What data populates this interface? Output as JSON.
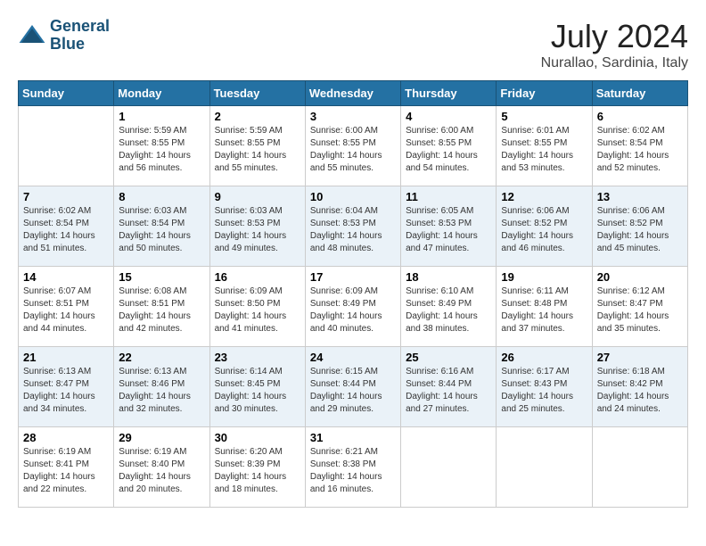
{
  "header": {
    "logo_line1": "General",
    "logo_line2": "Blue",
    "month_year": "July 2024",
    "location": "Nurallao, Sardinia, Italy"
  },
  "columns": [
    "Sunday",
    "Monday",
    "Tuesday",
    "Wednesday",
    "Thursday",
    "Friday",
    "Saturday"
  ],
  "weeks": [
    [
      {
        "day": "",
        "info": ""
      },
      {
        "day": "1",
        "info": "Sunrise: 5:59 AM\nSunset: 8:55 PM\nDaylight: 14 hours\nand 56 minutes."
      },
      {
        "day": "2",
        "info": "Sunrise: 5:59 AM\nSunset: 8:55 PM\nDaylight: 14 hours\nand 55 minutes."
      },
      {
        "day": "3",
        "info": "Sunrise: 6:00 AM\nSunset: 8:55 PM\nDaylight: 14 hours\nand 55 minutes."
      },
      {
        "day": "4",
        "info": "Sunrise: 6:00 AM\nSunset: 8:55 PM\nDaylight: 14 hours\nand 54 minutes."
      },
      {
        "day": "5",
        "info": "Sunrise: 6:01 AM\nSunset: 8:55 PM\nDaylight: 14 hours\nand 53 minutes."
      },
      {
        "day": "6",
        "info": "Sunrise: 6:02 AM\nSunset: 8:54 PM\nDaylight: 14 hours\nand 52 minutes."
      }
    ],
    [
      {
        "day": "7",
        "info": "Sunrise: 6:02 AM\nSunset: 8:54 PM\nDaylight: 14 hours\nand 51 minutes."
      },
      {
        "day": "8",
        "info": "Sunrise: 6:03 AM\nSunset: 8:54 PM\nDaylight: 14 hours\nand 50 minutes."
      },
      {
        "day": "9",
        "info": "Sunrise: 6:03 AM\nSunset: 8:53 PM\nDaylight: 14 hours\nand 49 minutes."
      },
      {
        "day": "10",
        "info": "Sunrise: 6:04 AM\nSunset: 8:53 PM\nDaylight: 14 hours\nand 48 minutes."
      },
      {
        "day": "11",
        "info": "Sunrise: 6:05 AM\nSunset: 8:53 PM\nDaylight: 14 hours\nand 47 minutes."
      },
      {
        "day": "12",
        "info": "Sunrise: 6:06 AM\nSunset: 8:52 PM\nDaylight: 14 hours\nand 46 minutes."
      },
      {
        "day": "13",
        "info": "Sunrise: 6:06 AM\nSunset: 8:52 PM\nDaylight: 14 hours\nand 45 minutes."
      }
    ],
    [
      {
        "day": "14",
        "info": "Sunrise: 6:07 AM\nSunset: 8:51 PM\nDaylight: 14 hours\nand 44 minutes."
      },
      {
        "day": "15",
        "info": "Sunrise: 6:08 AM\nSunset: 8:51 PM\nDaylight: 14 hours\nand 42 minutes."
      },
      {
        "day": "16",
        "info": "Sunrise: 6:09 AM\nSunset: 8:50 PM\nDaylight: 14 hours\nand 41 minutes."
      },
      {
        "day": "17",
        "info": "Sunrise: 6:09 AM\nSunset: 8:49 PM\nDaylight: 14 hours\nand 40 minutes."
      },
      {
        "day": "18",
        "info": "Sunrise: 6:10 AM\nSunset: 8:49 PM\nDaylight: 14 hours\nand 38 minutes."
      },
      {
        "day": "19",
        "info": "Sunrise: 6:11 AM\nSunset: 8:48 PM\nDaylight: 14 hours\nand 37 minutes."
      },
      {
        "day": "20",
        "info": "Sunrise: 6:12 AM\nSunset: 8:47 PM\nDaylight: 14 hours\nand 35 minutes."
      }
    ],
    [
      {
        "day": "21",
        "info": "Sunrise: 6:13 AM\nSunset: 8:47 PM\nDaylight: 14 hours\nand 34 minutes."
      },
      {
        "day": "22",
        "info": "Sunrise: 6:13 AM\nSunset: 8:46 PM\nDaylight: 14 hours\nand 32 minutes."
      },
      {
        "day": "23",
        "info": "Sunrise: 6:14 AM\nSunset: 8:45 PM\nDaylight: 14 hours\nand 30 minutes."
      },
      {
        "day": "24",
        "info": "Sunrise: 6:15 AM\nSunset: 8:44 PM\nDaylight: 14 hours\nand 29 minutes."
      },
      {
        "day": "25",
        "info": "Sunrise: 6:16 AM\nSunset: 8:44 PM\nDaylight: 14 hours\nand 27 minutes."
      },
      {
        "day": "26",
        "info": "Sunrise: 6:17 AM\nSunset: 8:43 PM\nDaylight: 14 hours\nand 25 minutes."
      },
      {
        "day": "27",
        "info": "Sunrise: 6:18 AM\nSunset: 8:42 PM\nDaylight: 14 hours\nand 24 minutes."
      }
    ],
    [
      {
        "day": "28",
        "info": "Sunrise: 6:19 AM\nSunset: 8:41 PM\nDaylight: 14 hours\nand 22 minutes."
      },
      {
        "day": "29",
        "info": "Sunrise: 6:19 AM\nSunset: 8:40 PM\nDaylight: 14 hours\nand 20 minutes."
      },
      {
        "day": "30",
        "info": "Sunrise: 6:20 AM\nSunset: 8:39 PM\nDaylight: 14 hours\nand 18 minutes."
      },
      {
        "day": "31",
        "info": "Sunrise: 6:21 AM\nSunset: 8:38 PM\nDaylight: 14 hours\nand 16 minutes."
      },
      {
        "day": "",
        "info": ""
      },
      {
        "day": "",
        "info": ""
      },
      {
        "day": "",
        "info": ""
      }
    ]
  ]
}
